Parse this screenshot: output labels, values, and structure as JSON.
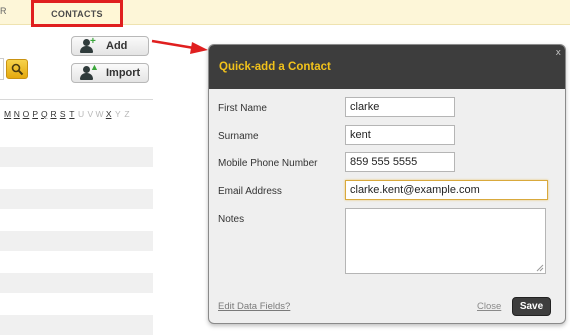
{
  "nav": {
    "left_fragment": "R",
    "active_tab": "CONTACTS"
  },
  "toolbar": {
    "add_label": "Add",
    "import_label": "Import"
  },
  "alphabet": {
    "letters": [
      {
        "letter": "M",
        "active": true
      },
      {
        "letter": "N",
        "active": true
      },
      {
        "letter": "O",
        "active": true
      },
      {
        "letter": "P",
        "active": true
      },
      {
        "letter": "Q",
        "active": true
      },
      {
        "letter": "R",
        "active": true
      },
      {
        "letter": "S",
        "active": true
      },
      {
        "letter": "T",
        "active": true
      },
      {
        "letter": "U",
        "active": false
      },
      {
        "letter": "V",
        "active": false
      },
      {
        "letter": "W",
        "active": false
      },
      {
        "letter": "X",
        "active": true
      },
      {
        "letter": "Y",
        "active": false
      },
      {
        "letter": "Z",
        "active": false
      }
    ]
  },
  "modal": {
    "title": "Quick-add a Contact",
    "close_x": "x",
    "fields": {
      "first_name": {
        "label": "First Name",
        "value": "clarke"
      },
      "surname": {
        "label": "Surname",
        "value": "kent"
      },
      "mobile": {
        "label": "Mobile Phone Number",
        "value": "859 555 5555"
      },
      "email": {
        "label": "Email Address",
        "value": "clarke.kent@example.com"
      },
      "notes": {
        "label": "Notes",
        "value": ""
      }
    },
    "edit_link": "Edit Data Fields?",
    "close_link": "Close",
    "save_label": "Save"
  },
  "colors": {
    "highlight_border": "#e01f1f",
    "modal_title": "#f2c21b",
    "modal_header": "#3d3d3d"
  }
}
